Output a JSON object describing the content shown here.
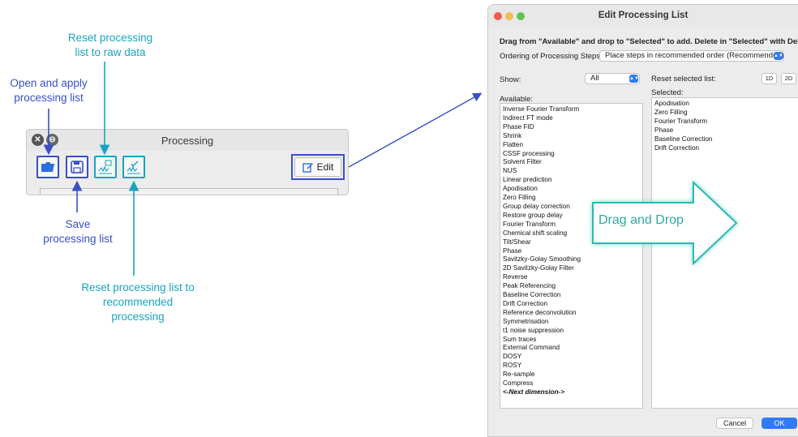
{
  "annotations": {
    "reset_raw": "Reset processing\nlist to raw data",
    "open_apply": "Open and apply\nprocessing list",
    "save": "Save\nprocessing list",
    "reset_recommended": "Reset processing list to\nrecommended\nprocessing",
    "drag_drop": "Drag and Drop"
  },
  "processing_panel": {
    "title": "Processing",
    "edit_label": "Edit"
  },
  "dialog": {
    "title": "Edit Processing List",
    "instructions": "Drag from \"Available\" and drop to \"Selected\" to add. Delete in \"Selected\" with Del key.",
    "ordering_label": "Ordering of Processing Steps:",
    "ordering_value": "Place steps in recommended order (Recommended)",
    "show_label": "Show:",
    "show_value": "All",
    "reset_selected_label": "Reset selected list:",
    "btn_1d": "1D",
    "btn_2d": "2D",
    "available_label": "Available:",
    "selected_label": "Selected:",
    "available": [
      "Inverse Fourier Transform",
      "Indirect FT mode",
      "Phase FID",
      "Shrink",
      "Flatten",
      "CSSF processing",
      "Solvent Filter",
      "NUS",
      "Linear prediction",
      "Apodisation",
      "Zero Filling",
      "Group delay correction",
      "Restore group delay",
      "Fourier Transform",
      "Chemical shift scaling",
      "Tilt/Shear",
      "Phase",
      "Savitzky-Golay Smoothing",
      "2D Savitzky-Golay Filter",
      "Reverse",
      "Peak Referencing",
      "Baseline Correction",
      "Drift Correction",
      "Reference deconvolution",
      "Symmetrisation",
      "t1 noise suppression",
      "Sum traces",
      "External Command",
      "DOSY",
      "ROSY",
      "Re-sample",
      "Compress",
      "<-Next dimension->"
    ],
    "selected": [
      "Apodisation",
      "Zero Filling",
      "Fourier Transform",
      "Phase",
      "Baseline Correction",
      "Drift Correction"
    ],
    "cancel_label": "Cancel",
    "ok_label": "OK"
  },
  "colors": {
    "callout_blue": "#3a4fc7",
    "callout_teal": "#1aa3bf",
    "arrow_teal": "#2fb8b0",
    "macos_blue": "#2f7bf6"
  }
}
